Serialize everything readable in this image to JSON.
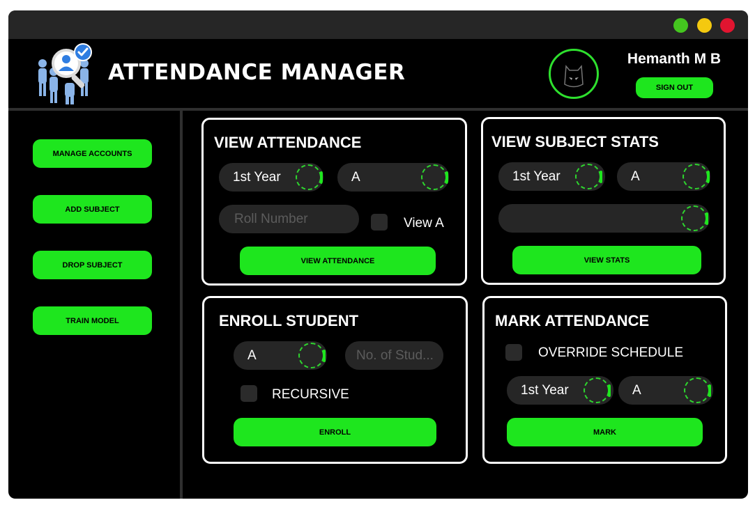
{
  "window": {
    "controls": [
      {
        "name": "maximize",
        "color": "#44c61f"
      },
      {
        "name": "minimize",
        "color": "#f4c90f"
      },
      {
        "name": "close",
        "color": "#e11530"
      }
    ]
  },
  "header": {
    "logo_icon": "users-search-check-icon",
    "title": "ATTENDANCE MANAGER",
    "avatar_icon": "batman-mask-icon",
    "user_name": "Hemanth M B",
    "sign_out_label": "SIGN OUT"
  },
  "sidebar": {
    "items": [
      {
        "label": "MANAGE ACCOUNTS"
      },
      {
        "label": "ADD SUBJECT"
      },
      {
        "label": "DROP SUBJECT"
      },
      {
        "label": "TRAIN MODEL"
      }
    ]
  },
  "view_attendance": {
    "title": "VIEW ATTENDANCE",
    "year_value": "1st Year",
    "section_value": "A",
    "roll_placeholder": "Roll Number",
    "view_all_label": "View A",
    "button_label": "VIEW ATTENDANCE"
  },
  "view_subject_stats": {
    "title": "VIEW SUBJECT STATS",
    "year_value": "1st Year",
    "section_value": "A",
    "subject_value": "",
    "button_label": "VIEW STATS"
  },
  "enroll_student": {
    "title": "ENROLL STUDENT",
    "section_value": "A",
    "count_placeholder": "No. of Stud...",
    "recursive_label": "RECURSIVE",
    "button_label": "ENROLL"
  },
  "mark_attendance": {
    "title": "MARK ATTENDANCE",
    "override_label": "OVERRIDE SCHEDULE",
    "year_value": "1st Year",
    "section_value": "A",
    "button_label": "MARK"
  },
  "colors": {
    "accent": "#1ee61e",
    "background": "#000000",
    "titlebar": "#262626",
    "control": "#262626"
  }
}
